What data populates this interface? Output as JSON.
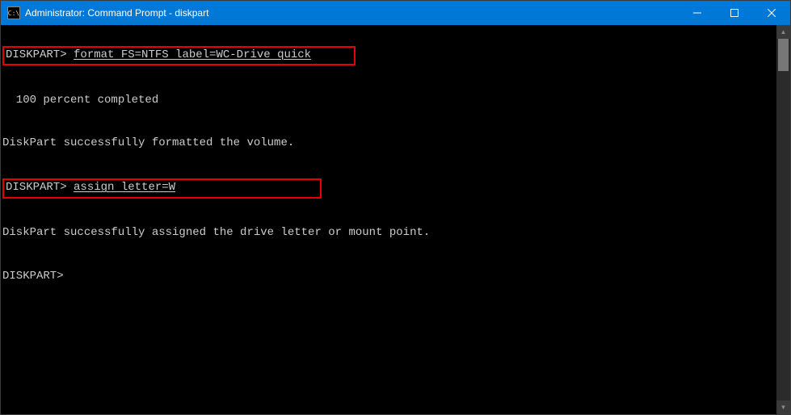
{
  "window": {
    "title": "Administrator: Command Prompt - diskpart"
  },
  "terminal": {
    "prompt": "DISKPART>",
    "lines": {
      "cmd1": "format FS=NTFS label=WC-Drive quick",
      "progress": "  100 percent completed",
      "result1": "DiskPart successfully formatted the volume.",
      "cmd2": "assign letter=W",
      "result2": "DiskPart successfully assigned the drive letter or mount point."
    }
  }
}
